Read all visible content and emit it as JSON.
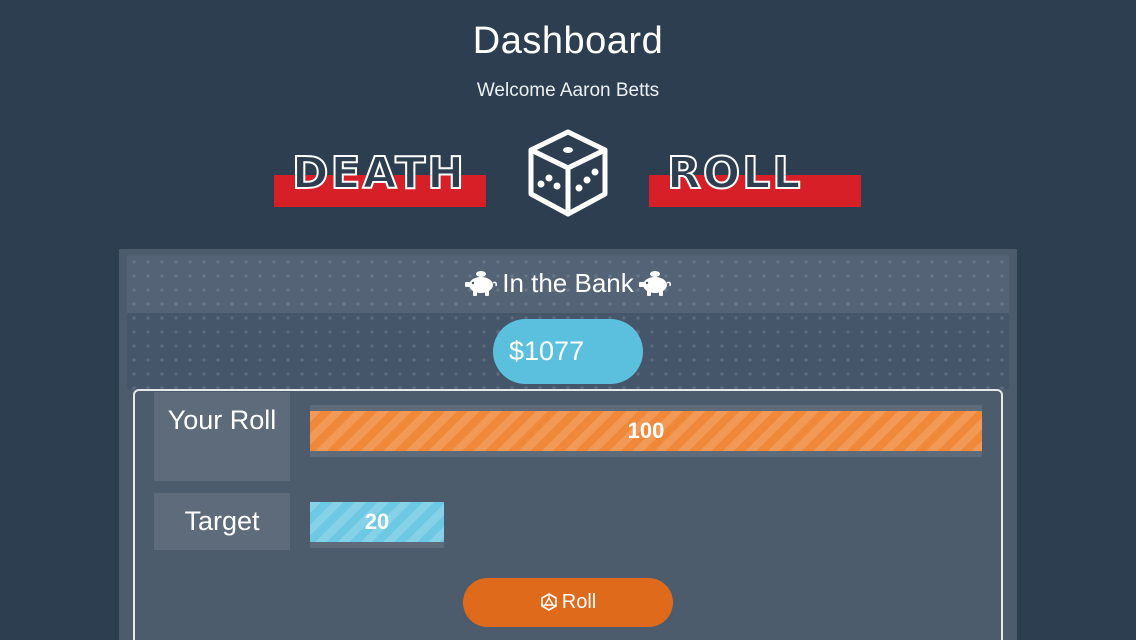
{
  "header": {
    "title": "Dashboard",
    "welcome": "Welcome Aaron Betts"
  },
  "logo": {
    "word_left": "Death",
    "word_right": "Roll",
    "icon": "dice-icon",
    "band_color": "#d61f26"
  },
  "bank": {
    "title": "In the Bank",
    "icon": "piggy-bank-icon",
    "amount": "$1077",
    "pill_color": "#5bc0de"
  },
  "game": {
    "your_roll_label": "Your Roll",
    "your_roll_value": "100",
    "your_roll_fraction": 1.0,
    "target_label": "Target",
    "target_value": "20",
    "target_fraction": 0.2,
    "roll_color": "#f0883a",
    "target_color": "#6dc8e3"
  },
  "actions": {
    "roll_label": "Roll",
    "roll_icon": "d20-icon",
    "roll_color": "#e06a1c"
  }
}
